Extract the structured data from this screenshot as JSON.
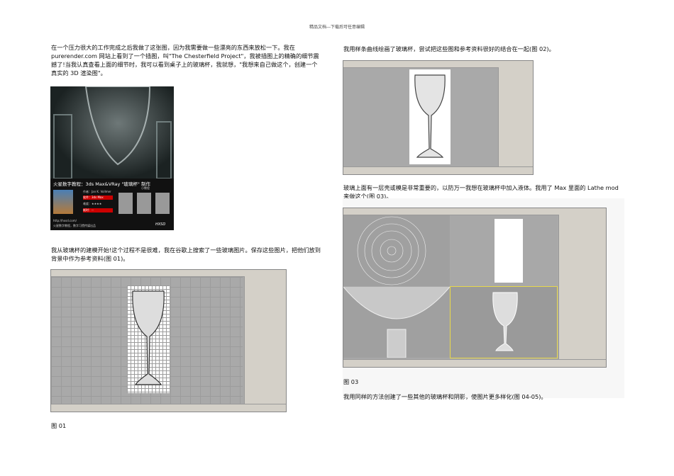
{
  "header": "精品文档---下载后可任意编辑",
  "left": {
    "para1": [
      "在一个压力很大的工作完成之后我做了这张图，因为我需要做一些漂亮的东西来放松一下。我在",
      "purerender.com 网站上看到了一个插图，叫\"The Chesterfield Project\"，我被插图上的精确的细节震",
      "撼了!当我认真查看上面的细节时，我可以看到桌子上的玻璃杯，我就想，\"我想来自己做这个，创建一个",
      "真实的 3D 渲染图\"。"
    ],
    "banner": {
      "title": "火星数字教程：3ds Max&VRay \"玻璃杯\" 制作",
      "author": "作者：Jan K. Vollmer",
      "software": "软件：3ds Max",
      "rating": "难度：★★★★",
      "time": "耗时：--",
      "thumbs_label": "小教程",
      "url": "http://hxsd.com/",
      "footer": "火星数字教程，数字习惯传媒出品",
      "logo": "HXSD"
    },
    "para2": [
      "我从玻璃杯的建模开始!这个过程不是很难，我在谷歌上搜索了一些玻璃图片。保存这些图片，把他们放到",
      "背景中作为参考资料(图 01)。"
    ],
    "fig01_caption": "图 01"
  },
  "right": {
    "para1": "我用样条曲线绘画了玻璃杯，尝试把这些图和参考资料很好的结合在一起(图 02)。",
    "para2": [
      "玻璃上面有一层壳或模是非常重要的，以防万一我想在玻璃杯中加入液体。我用了 Max 里面的 Lathe mod",
      "来做这个(图 03)。"
    ],
    "fig03_caption": "图 03",
    "para3": "我用同样的方法创建了一些其他的玻璃杯和阴影，使图片更多样化(图 04-05)。"
  }
}
